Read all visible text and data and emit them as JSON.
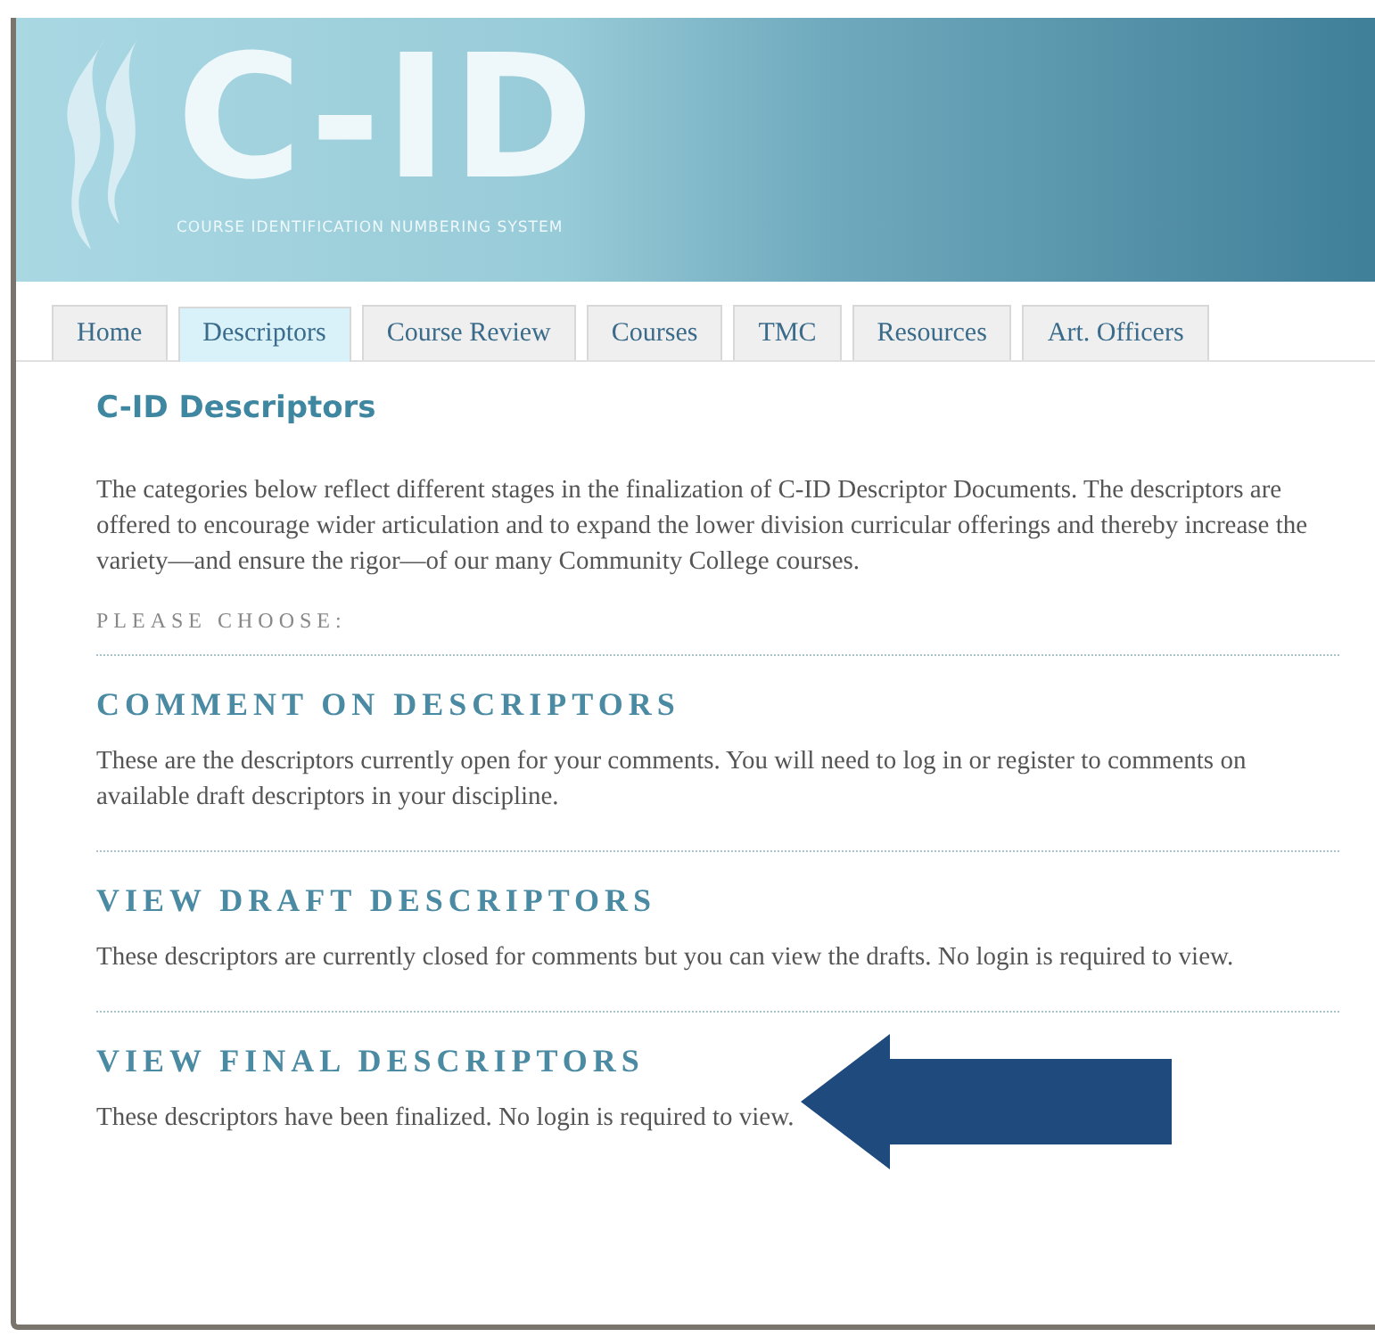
{
  "banner": {
    "logo": "C-ID",
    "tagline": "COURSE IDENTIFICATION NUMBERING SYSTEM"
  },
  "tabs": [
    {
      "label": "Home",
      "selected": false
    },
    {
      "label": "Descriptors",
      "selected": true
    },
    {
      "label": "Course Review",
      "selected": false
    },
    {
      "label": "Courses",
      "selected": false
    },
    {
      "label": "TMC",
      "selected": false
    },
    {
      "label": "Resources",
      "selected": false
    },
    {
      "label": "Art. Officers",
      "selected": false
    }
  ],
  "page": {
    "title": "C-ID Descriptors",
    "intro": "The categories below reflect different stages in the finalization of C-ID Descriptor Documents. The descriptors are offered to encourage wider articulation and to expand the lower division curricular offerings and thereby increase the variety—and ensure the rigor—of our many Community College courses.",
    "prompt": "PLEASE CHOOSE:"
  },
  "sections": [
    {
      "heading": "COMMENT ON DESCRIPTORS",
      "text": "These are the descriptors currently open for your comments. You will need to log in or register to comments on available draft descriptors in your discipline."
    },
    {
      "heading": "VIEW DRAFT DESCRIPTORS",
      "text": "These descriptors are currently closed for comments but you can view the drafts. No login is required to view."
    },
    {
      "heading": "VIEW FINAL DESCRIPTORS",
      "text": "These descriptors have been finalized. No login is required to view."
    }
  ]
}
